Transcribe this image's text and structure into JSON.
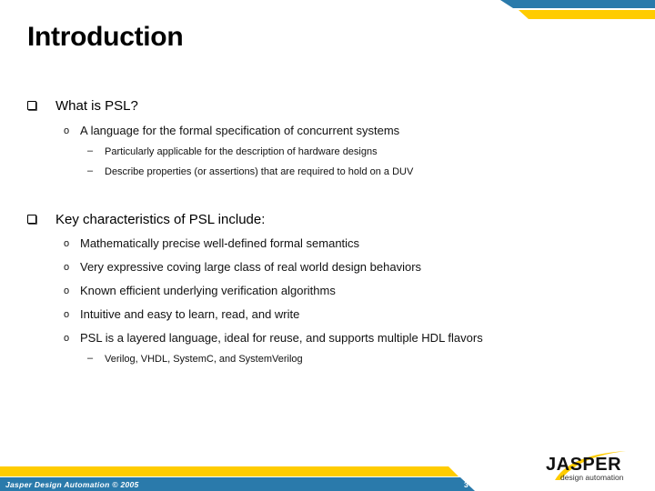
{
  "slide": {
    "title": "Introduction",
    "sections": [
      {
        "heading": "What is PSL?",
        "items": [
          {
            "text": "A language for the formal specification of concurrent systems",
            "subitems": [
              "Particularly applicable for the description of hardware designs",
              "Describe properties (or assertions) that are required to hold on a DUV"
            ]
          }
        ]
      },
      {
        "heading": "Key characteristics of PSL include:",
        "items": [
          {
            "text": "Mathematically precise well-defined formal semantics",
            "subitems": []
          },
          {
            "text": "Very expressive coving large class of real world design behaviors",
            "subitems": []
          },
          {
            "text": "Known efficient underlying verification algorithms",
            "subitems": []
          },
          {
            "text": "Intuitive and easy to learn, read, and write",
            "subitems": []
          },
          {
            "text": "PSL is a layered language, ideal for reuse, and supports multiple HDL flavors",
            "subitems": [
              "Verilog, VHDL, SystemC, and SystemVerilog"
            ]
          }
        ]
      }
    ],
    "bullets": {
      "level2": "o",
      "level3": "–"
    }
  },
  "footer": {
    "text": "Jasper Design Automation © 2005",
    "page_number": "3"
  },
  "logo": {
    "name": "JASPER",
    "tagline": "design automation"
  },
  "colors": {
    "brand_blue": "#2a7aab",
    "brand_yellow": "#ffcc00"
  }
}
